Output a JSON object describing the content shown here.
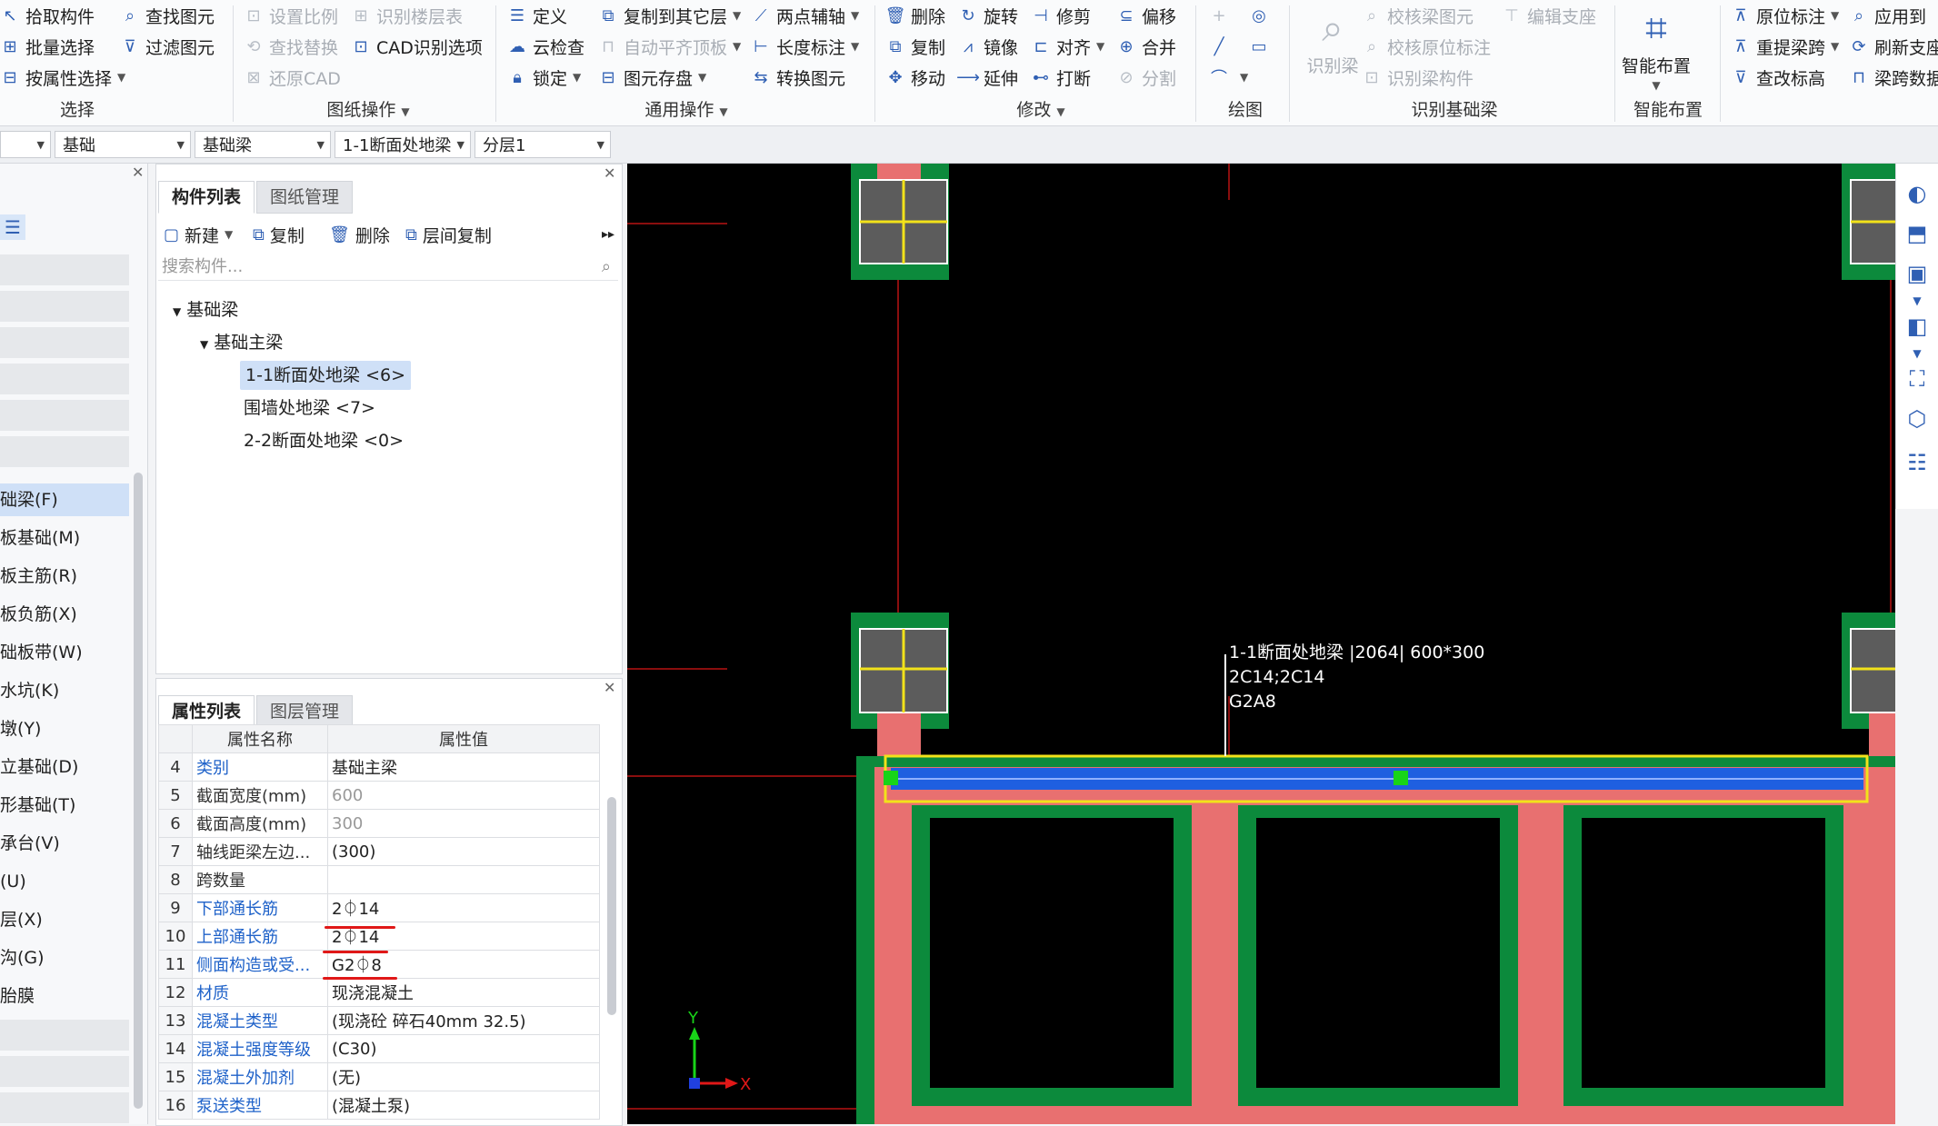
{
  "ribbon": {
    "select": {
      "items": [
        "拾取构件",
        "批量选择",
        "按属性选择"
      ],
      "col2": [
        "查找图元",
        "过滤图元"
      ],
      "label": "选择"
    },
    "drawing_ops": {
      "col1": [
        "设置比例",
        "查找替换",
        "还原CAD"
      ],
      "col2": [
        "识别楼层表",
        "CAD识别选项"
      ],
      "label": "图纸操作"
    },
    "general_ops": {
      "col1": [
        "定义",
        "云检查",
        "锁定"
      ],
      "col2": [
        "复制到其它层",
        "自动平齐顶板",
        "图元存盘"
      ],
      "col3": [
        "两点辅轴",
        "长度标注",
        "转换图元"
      ],
      "label": "通用操作"
    },
    "modify": {
      "col1": [
        "删除",
        "复制",
        "移动"
      ],
      "col2": [
        "旋转",
        "镜像",
        "延伸"
      ],
      "col3": [
        "修剪",
        "对齐",
        "打断"
      ],
      "col4": [
        "偏移",
        "合并",
        "分割"
      ],
      "label": "修改"
    },
    "draw": {
      "label": "绘图"
    },
    "recognize_beam": {
      "big": "识别梁",
      "items": [
        "校核梁图元",
        "校核原位标注",
        "识别梁构件"
      ],
      "extra": "编辑支座",
      "label": "识别基础梁"
    },
    "smart": {
      "big": "智能布置",
      "label": "智能布置"
    },
    "right": {
      "col1": [
        "原位标注",
        "重提梁跨",
        "查改标高"
      ],
      "col2": [
        "应用到",
        "刷新支座",
        "梁跨数据"
      ]
    }
  },
  "filterbar": {
    "selects": [
      "",
      "基础",
      "基础梁",
      "1-1断面处地梁",
      "分层1"
    ]
  },
  "leftnav": {
    "items": [
      "础梁(F)",
      "板基础(M)",
      "板主筋(R)",
      "板负筋(X)",
      "础板带(W)",
      "水坑(K)",
      "墩(Y)",
      "立基础(D)",
      "形基础(T)",
      "承台(V)",
      "(U)",
      "层(X)",
      "沟(G)",
      "胎膜"
    ]
  },
  "component_panel": {
    "tabs": [
      "构件列表",
      "图纸管理"
    ],
    "toolbar": [
      "新建",
      "复制",
      "删除",
      "层间复制"
    ],
    "search_placeholder": "搜索构件...",
    "tree": {
      "root": "基础梁",
      "child": "基础主梁",
      "items": [
        "1-1断面处地梁 <6>",
        "围墙处地梁 <7>",
        "2-2断面处地梁 <0>"
      ]
    }
  },
  "property_panel": {
    "tabs": [
      "属性列表",
      "图层管理"
    ],
    "headers": [
      "属性名称",
      "属性值"
    ],
    "rows": [
      {
        "no": "4",
        "name": "类别",
        "value": "基础主梁"
      },
      {
        "no": "5",
        "name": "截面宽度(mm)",
        "value": "600"
      },
      {
        "no": "6",
        "name": "截面高度(mm)",
        "value": "300"
      },
      {
        "no": "7",
        "name": "轴线距梁左边...",
        "value": "(300)"
      },
      {
        "no": "8",
        "name": "跨数量",
        "value": ""
      },
      {
        "no": "9",
        "name": "下部通长筋",
        "value": "2⏀14"
      },
      {
        "no": "10",
        "name": "上部通长筋",
        "value": "2⏀14"
      },
      {
        "no": "11",
        "name": "侧面构造或受...",
        "value": "G2⏀8"
      },
      {
        "no": "12",
        "name": "材质",
        "value": "现浇混凝土"
      },
      {
        "no": "13",
        "name": "混凝土类型",
        "value": "(现浇砼 碎石40mm 32.5)"
      },
      {
        "no": "14",
        "name": "混凝土强度等级",
        "value": "(C30)"
      },
      {
        "no": "15",
        "name": "混凝土外加剂",
        "value": "(无)"
      },
      {
        "no": "16",
        "name": "泵送类型",
        "value": "(混凝土泵)"
      }
    ]
  },
  "canvas": {
    "annotation": [
      "1-1断面处地梁 |2064| 600*300",
      "2C14;2C14",
      "G2A8"
    ],
    "axis": {
      "x": "X",
      "y": "Y"
    }
  },
  "colors": {
    "beam": "#1f5fe0",
    "concrete": "#e87070",
    "foundation": "#0c8a3c",
    "column": "#5c5c5c",
    "highlight": "#f2e21a",
    "axis": "#8a0e0e"
  }
}
